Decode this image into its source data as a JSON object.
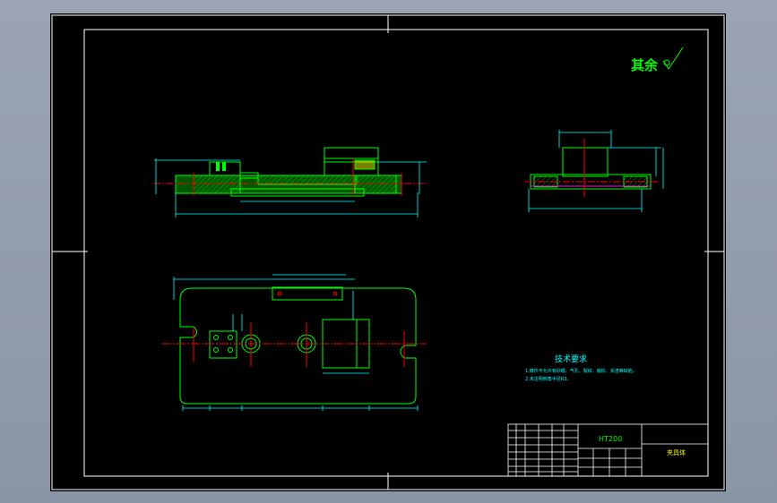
{
  "drawing": {
    "roughness_note": "其余",
    "tech_requirements": {
      "title": "技术要求",
      "items": [
        "1.铸件不允许有砂眼、气孔、裂纹、缩松、夹渣等缺陷。",
        "2.未注明倒角半径R3。"
      ]
    },
    "title_block": {
      "material": "HT200",
      "part_name": "夹具体"
    }
  },
  "colors": {
    "viewport_bg": "#000000",
    "outline": "#ffffff",
    "geometry": "#00ff00",
    "dimensions": "#00ffff",
    "centerline": "#ff0000",
    "text": "#ffff00"
  }
}
